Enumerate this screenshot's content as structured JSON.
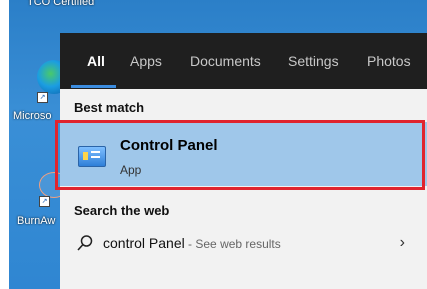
{
  "desktop": {
    "top_label": "TCO Certified",
    "edge_label": "Microso",
    "burn_label": "BurnAw"
  },
  "start_menu": {
    "tabs": [
      {
        "label": "All",
        "active": true
      },
      {
        "label": "Apps",
        "active": false
      },
      {
        "label": "Documents",
        "active": false
      },
      {
        "label": "Settings",
        "active": false
      },
      {
        "label": "Photos",
        "active": false
      }
    ],
    "best_match_header": "Best match",
    "best_match": {
      "title": "Control Panel",
      "subtitle": "App",
      "icon": "control-panel-icon"
    },
    "web_header": "Search the web",
    "web_result": {
      "query": "control Panel",
      "hint": " - See web results",
      "icon": "search-icon"
    }
  },
  "colors": {
    "tab_bar": "#1f1f1f",
    "accent": "#3c8de0",
    "selected_bg": "#9fc7ea",
    "highlight_border": "#e0242e"
  }
}
